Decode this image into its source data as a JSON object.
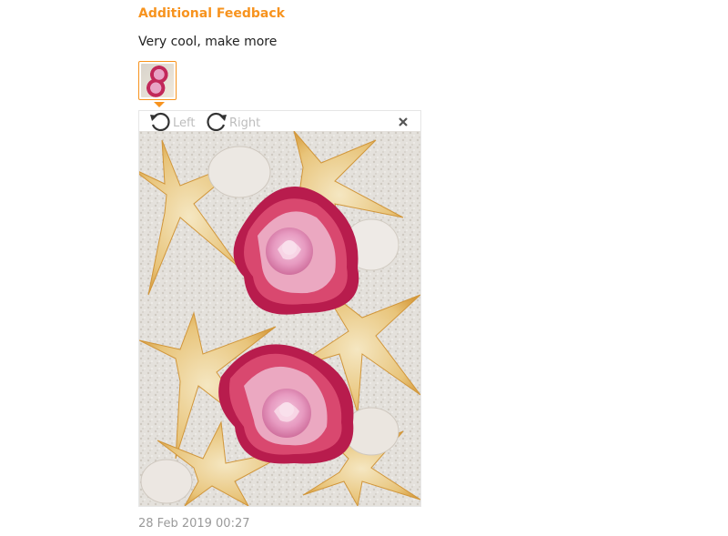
{
  "feedback": {
    "title": "Additional Feedback",
    "text": "Very cool, make more",
    "date": "28 Feb 2019 00:27"
  },
  "viewer": {
    "rotate_left_label": "Left",
    "rotate_right_label": "Right",
    "close_icon": "close-icon",
    "rotate_left_icon": "rotate-left-icon",
    "rotate_right_icon": "rotate-right-icon"
  },
  "colors": {
    "accent": "#f7931e",
    "text": "#222222",
    "muted": "#9a9a9a",
    "tool_label": "#bdbdbd"
  }
}
